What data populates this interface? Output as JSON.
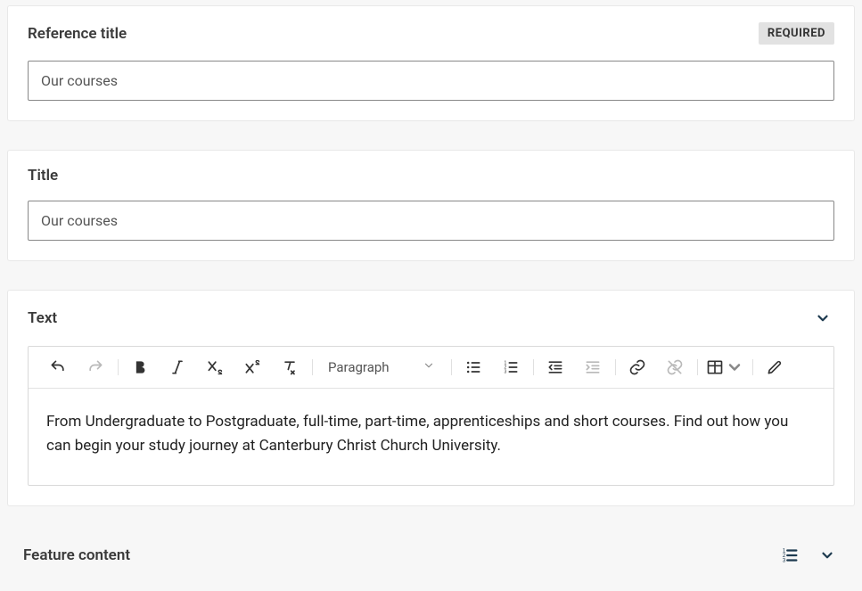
{
  "refTitle": {
    "label": "Reference title",
    "badge": "REQUIRED",
    "value": "Our courses"
  },
  "title": {
    "label": "Title",
    "value": "Our courses"
  },
  "text": {
    "label": "Text",
    "formatLabel": "Paragraph",
    "body": "From Undergraduate to Postgraduate, full-time, part-time, apprenticeships and short courses. Find out how you can begin your study journey at Canterbury Christ Church University."
  },
  "feature": {
    "label": "Feature content"
  }
}
